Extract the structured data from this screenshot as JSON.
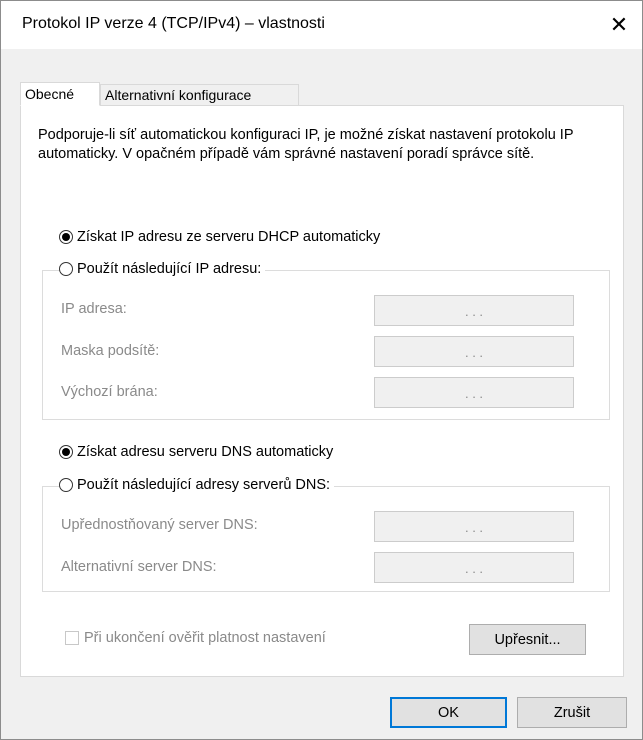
{
  "window": {
    "title": "Protokol IP verze 4 (TCP/IPv4) – vlastnosti",
    "close_glyph": "✕"
  },
  "tabs": [
    {
      "label": "Obecné"
    },
    {
      "label": "Alternativní konfigurace"
    }
  ],
  "description": "Podporuje-li síť automatickou konfiguraci IP, je možné získat nastavení protokolu IP automaticky. V opačném případě vám správné nastavení poradí správce sítě.",
  "ip": {
    "auto_label": "Získat IP adresu ze serveru DHCP automaticky",
    "auto_selected": true,
    "manual_label": "Použít následující IP adresu:",
    "fields": [
      {
        "label": "IP adresa:",
        "value": ". . ."
      },
      {
        "label": "Maska podsítě:",
        "value": ". . ."
      },
      {
        "label": "Výchozí brána:",
        "value": ". . ."
      }
    ]
  },
  "dns": {
    "auto_label": "Získat adresu serveru DNS automaticky",
    "auto_selected": true,
    "manual_label": "Použít následující adresy serverů DNS:",
    "fields": [
      {
        "label": "Upřednostňovaný server DNS:",
        "value": ". . ."
      },
      {
        "label": "Alternativní server DNS:",
        "value": ". . ."
      }
    ]
  },
  "validate_label": "Při ukončení ověřit platnost nastavení",
  "validate_checked": false,
  "buttons": {
    "advanced": "Upřesnit...",
    "ok": "OK",
    "cancel": "Zrušit"
  }
}
